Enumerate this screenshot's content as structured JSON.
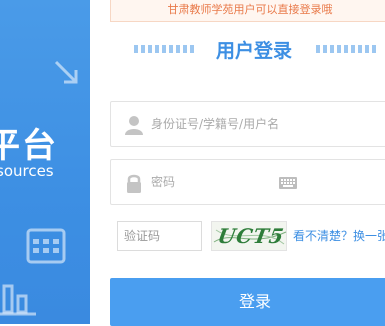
{
  "brand": {
    "title": "平台",
    "subtitle": "sources"
  },
  "notice": {
    "text": "甘肃教师学苑用户可以直接登录哦"
  },
  "login": {
    "heading": "用户登录",
    "username_placeholder": "身份证号/学籍号/用户名",
    "password_placeholder": "密码",
    "captcha_placeholder": "验证码",
    "captcha_code": "UCT5",
    "refresh_text": "看不清楚？换一张",
    "submit_label": "登录"
  },
  "colors": {
    "brand_blue": "#3d8fe3",
    "notice_text": "#e97a4a",
    "button": "#4a9ef0"
  }
}
